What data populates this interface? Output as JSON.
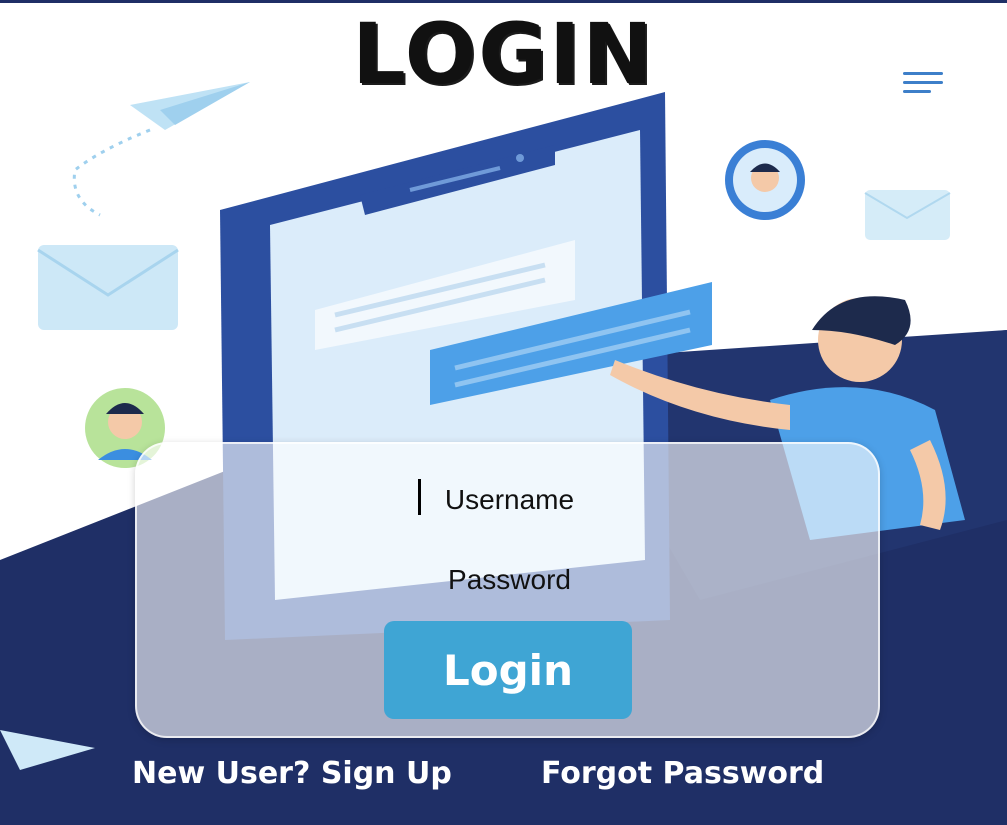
{
  "header": {
    "title": "LOGIN",
    "menu_icon": "hamburger-menu-icon"
  },
  "form": {
    "username_placeholder": "Username",
    "password_placeholder": "Password",
    "login_label": "Login"
  },
  "footer": {
    "signup_label": "New User? Sign Up",
    "forgot_label": "Forgot Password"
  },
  "colors": {
    "accent": "#3fa5d4",
    "dark_navy": "#1f2f66",
    "menu": "#3d7fc9",
    "illustration_blue": "#4da0e8"
  }
}
